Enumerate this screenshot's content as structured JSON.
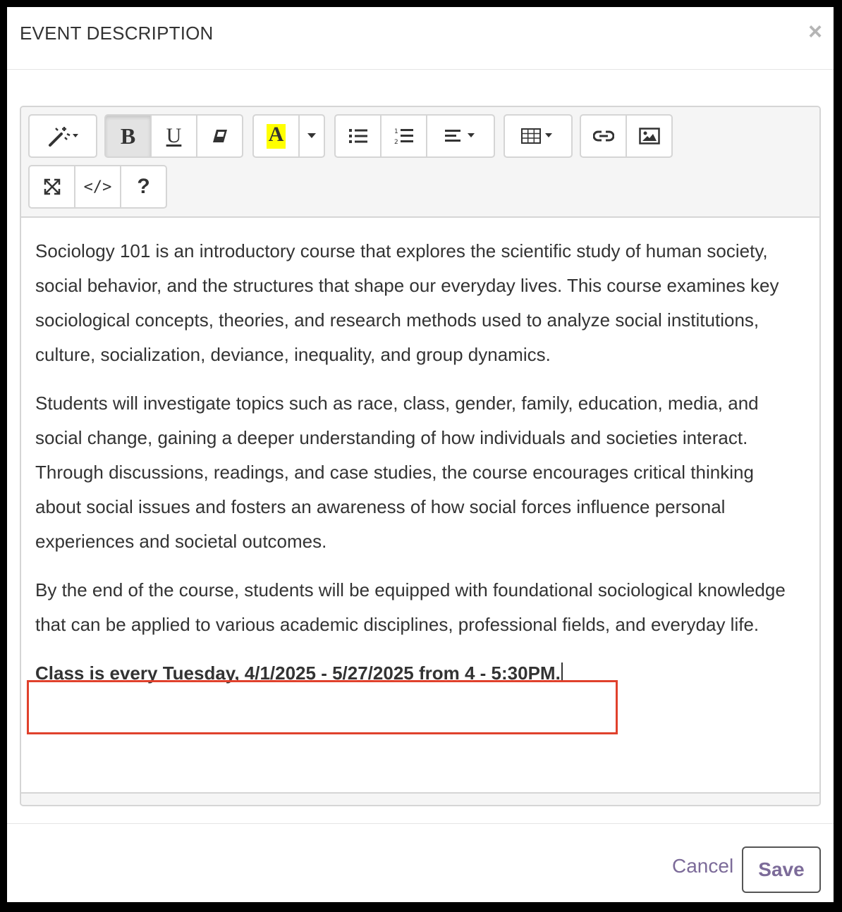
{
  "modal": {
    "title": "EVENT DESCRIPTION",
    "close_symbol": "×"
  },
  "toolbar": {
    "icons": {
      "style": "magic-wand-icon",
      "bold": "bold-icon",
      "underline": "underline-icon",
      "clear": "eraser-icon",
      "color": "font-color-icon",
      "unordered_list": "bulleted-list-icon",
      "ordered_list": "numbered-list-icon",
      "align": "align-icon",
      "table": "table-icon",
      "link": "link-icon",
      "image": "image-icon",
      "fullscreen": "fullscreen-icon",
      "code": "code-view-icon",
      "help": "help-icon"
    },
    "bold_label": "B",
    "underline_label": "U",
    "color_label": "A",
    "code_label": "</>",
    "help_label": "?",
    "highlight_color": "#ffff00"
  },
  "content": {
    "paragraphs": [
      "Sociology 101 is an introductory course that explores the scientific study of human society, social behavior, and the structures that shape our everyday lives. This course examines key sociological concepts, theories, and research methods used to analyze social institutions, culture, socialization, deviance, inequality, and group dynamics.",
      "Students will investigate topics such as race, class, gender, family, education, media, and social change, gaining a deeper understanding of how individuals and societies interact. Through discussions, readings, and case studies, the course encourages critical thinking about social issues and fosters an awareness of how social forces influence personal experiences and societal outcomes.",
      "By the end of the course, students will be equipped with foundational sociological knowledge that can be applied to various academic disciplines, professional fields, and everyday life."
    ],
    "schedule": "Class is every Tuesday, 4/1/2025 - 5/27/2025 from 4 - 5:30PM."
  },
  "footer": {
    "cancel_label": "Cancel",
    "save_label": "Save"
  },
  "colors": {
    "accent": "#7c6b99",
    "highlight_border": "#e0412c"
  }
}
